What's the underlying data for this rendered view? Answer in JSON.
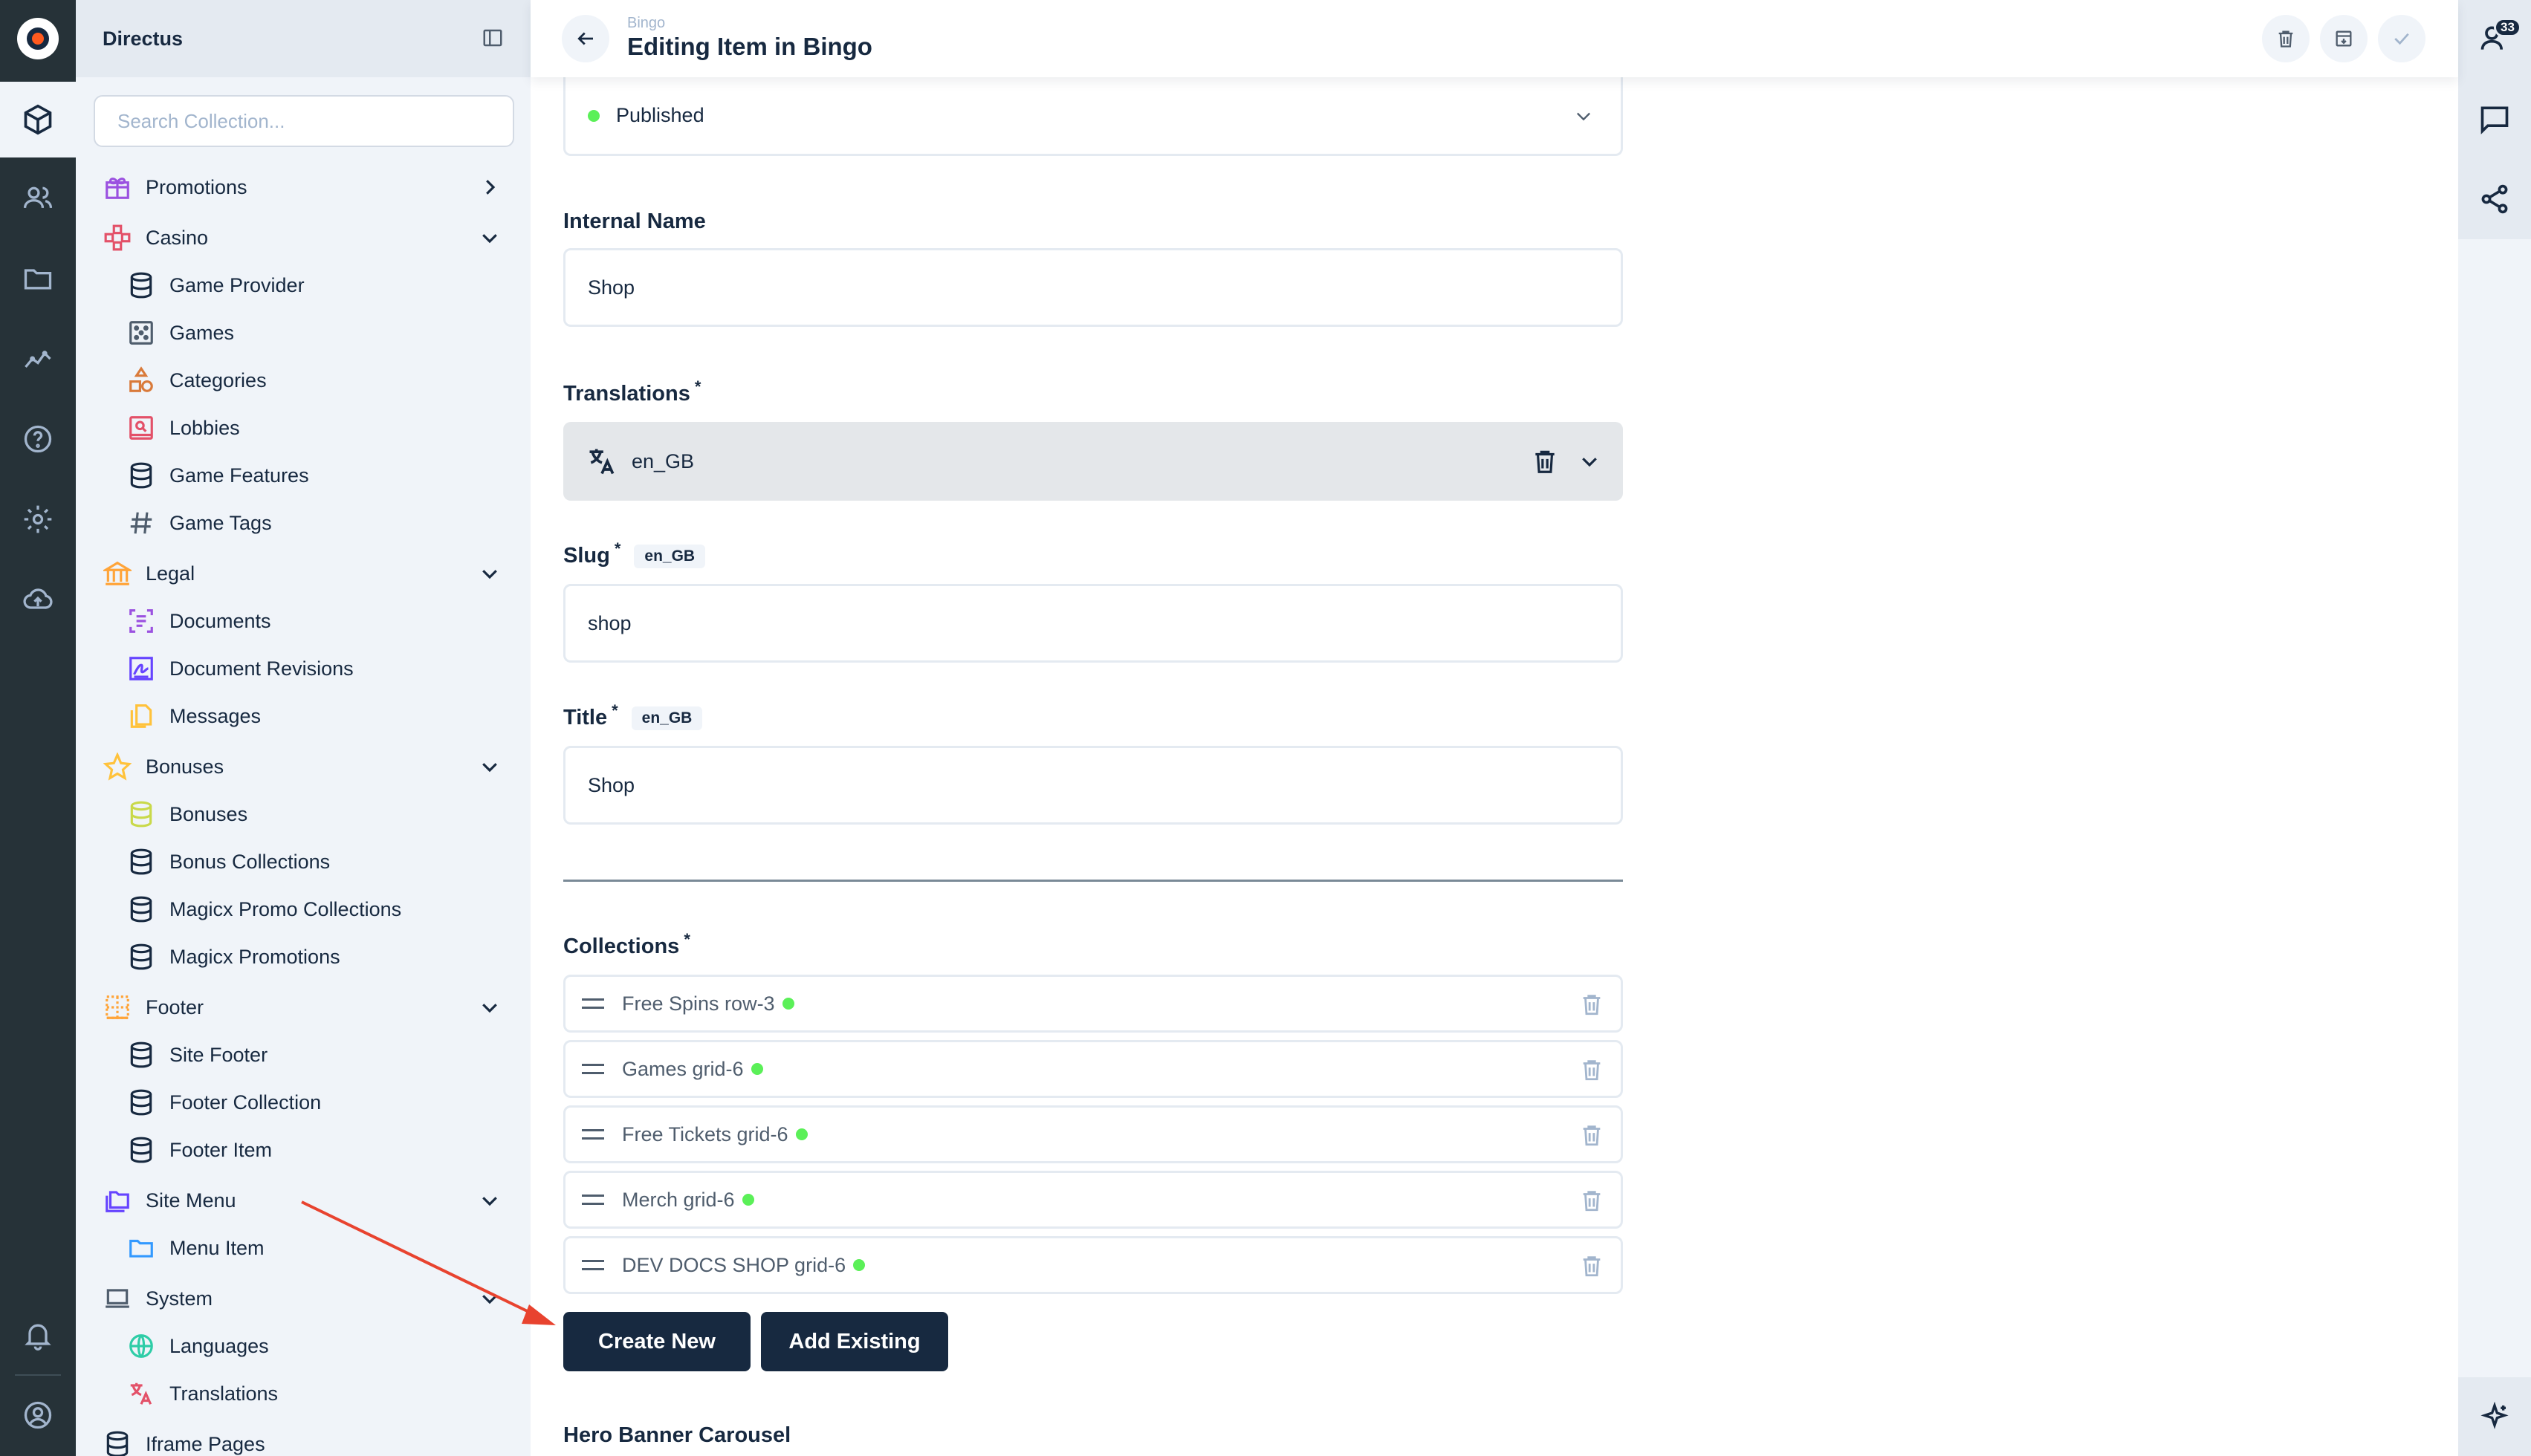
{
  "app": {
    "name": "Directus"
  },
  "header": {
    "breadcrumb": "Bingo",
    "title": "Editing Item in Bingo"
  },
  "notifications": {
    "count": "33"
  },
  "nav": {
    "search_placeholder": "Search Collection...",
    "groups": [
      {
        "label": "Promotions",
        "color": "#9b51e0"
      },
      {
        "label": "Casino",
        "color": "#e35169"
      },
      {
        "label": "Legal",
        "color": "#ffa439"
      },
      {
        "label": "Bonuses",
        "color": "#ffc23b"
      },
      {
        "label": "Footer",
        "color": "#ffa439"
      },
      {
        "label": "Site Menu",
        "color": "#6644ff"
      },
      {
        "label": "System",
        "color": "#4f5d6d"
      },
      {
        "label": "Iframe Pages",
        "color": "#172940"
      }
    ],
    "casino_children": [
      "Game Provider",
      "Games",
      "Categories",
      "Lobbies",
      "Game Features",
      "Game Tags"
    ],
    "legal_children": [
      "Documents",
      "Document Revisions",
      "Messages"
    ],
    "bonuses_children": [
      "Bonuses",
      "Bonus Collections",
      "Magicx Promo Collections",
      "Magicx Promotions"
    ],
    "footer_children": [
      "Site Footer",
      "Footer Collection",
      "Footer Item"
    ],
    "sitemenu_children": [
      "Menu Item"
    ],
    "system_children": [
      "Languages",
      "Translations"
    ]
  },
  "form": {
    "status": {
      "value": "Published",
      "color": "#2ecda7"
    },
    "internal_name": {
      "label": "Internal Name",
      "value": "Shop"
    },
    "translations": {
      "label": "Translations",
      "lang": "en_GB"
    },
    "slug": {
      "label": "Slug",
      "lang": "en_GB",
      "value": "shop"
    },
    "title": {
      "label": "Title",
      "lang": "en_GB",
      "value": "Shop"
    },
    "collections": {
      "label": "Collections",
      "items": [
        "Free Spins row-3",
        "Games grid-6",
        "Free Tickets grid-6",
        "Merch grid-6",
        "DEV DOCS SHOP grid-6"
      ],
      "create_label": "Create New",
      "add_label": "Add Existing"
    },
    "hero": {
      "label": "Hero Banner Carousel"
    }
  },
  "required_marker": "*",
  "annotation": {
    "arrow_color": "#e8432f"
  }
}
